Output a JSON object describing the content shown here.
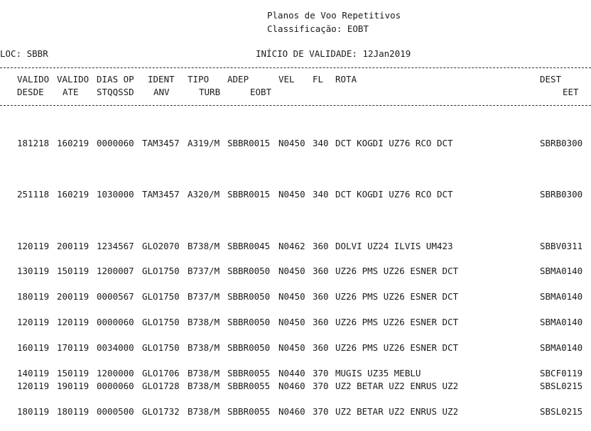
{
  "report": {
    "title": "Planos de Voo Repetitivos",
    "classification": "Classificação: EOBT",
    "loc": "LOC: SBBR",
    "validity": "INÍCIO DE VALIDADE: 12Jan2019"
  },
  "headers": {
    "row1": [
      {
        "text": "VALIDO",
        "col": "c0"
      },
      {
        "text": "VALIDO",
        "col": "c1"
      },
      {
        "text": "DIAS OP",
        "col": "c2"
      },
      {
        "text": "IDENT",
        "col": "c3i"
      },
      {
        "text": "TIPO",
        "col": "c4i"
      },
      {
        "text": "ADEP",
        "col": "c5i"
      },
      {
        "text": "VEL",
        "col": "c6i"
      },
      {
        "text": "FL",
        "col": "c7i"
      },
      {
        "text": "ROTA",
        "col": "c8"
      },
      {
        "text": "DEST",
        "col": "cd"
      }
    ],
    "row2": [
      {
        "text": "DESDE",
        "col": "c0"
      },
      {
        "text": "ATE",
        "col": "c1i"
      },
      {
        "text": "STQQSSD",
        "col": "c2"
      },
      {
        "text": "ANV",
        "col": "c3j"
      },
      {
        "text": "TURB",
        "col": "c4j"
      },
      {
        "text": "EOBT",
        "col": "c5j"
      },
      {
        "text": "EET",
        "col": "ce"
      }
    ]
  },
  "rows": [
    {
      "desde": "181218",
      "ate": "160219",
      "dias": "0000060",
      "ident": "TAM3457",
      "tipo": "A319/M",
      "adep": "SBBR0015",
      "vel": "N0450",
      "fl": "340",
      "rota": "DCT KOGDI UZ76 RCO DCT",
      "dest": "SBRB0300"
    },
    {
      "desde": "251118",
      "ate": "160219",
      "dias": "1030000",
      "ident": "TAM3457",
      "tipo": "A320/M",
      "adep": "SBBR0015",
      "vel": "N0450",
      "fl": "340",
      "rota": "DCT KOGDI UZ76 RCO DCT",
      "dest": "SBRB0300"
    },
    {
      "desde": "120119",
      "ate": "200119",
      "dias": "1234567",
      "ident": "GLO2070",
      "tipo": "B738/M",
      "adep": "SBBR0045",
      "vel": "N0462",
      "fl": "360",
      "rota": "DOLVI UZ24 ILVIS UM423",
      "dest": "SBBV0311"
    },
    {
      "desde": "130119",
      "ate": "150119",
      "dias": "1200007",
      "ident": "GLO1750",
      "tipo": "B737/M",
      "adep": "SBBR0050",
      "vel": "N0450",
      "fl": "360",
      "rota": "UZ26 PMS UZ26 ESNER DCT",
      "dest": "SBMA0140"
    },
    {
      "desde": "180119",
      "ate": "200119",
      "dias": "0000567",
      "ident": "GLO1750",
      "tipo": "B737/M",
      "adep": "SBBR0050",
      "vel": "N0450",
      "fl": "360",
      "rota": "UZ26 PMS UZ26 ESNER DCT",
      "dest": "SBMA0140"
    },
    {
      "desde": "120119",
      "ate": "120119",
      "dias": "0000060",
      "ident": "GLO1750",
      "tipo": "B738/M",
      "adep": "SBBR0050",
      "vel": "N0450",
      "fl": "360",
      "rota": "UZ26 PMS UZ26 ESNER DCT",
      "dest": "SBMA0140"
    },
    {
      "desde": "160119",
      "ate": "170119",
      "dias": "0034000",
      "ident": "GLO1750",
      "tipo": "B738/M",
      "adep": "SBBR0050",
      "vel": "N0450",
      "fl": "360",
      "rota": "UZ26 PMS UZ26 ESNER DCT",
      "dest": "SBMA0140"
    },
    {
      "desde": "140119",
      "ate": "150119",
      "dias": "1200000",
      "ident": "GLO1706",
      "tipo": "B738/M",
      "adep": "SBBR0055",
      "vel": "N0440",
      "fl": "370",
      "rota": "MUGIS UZ35 MEBLU",
      "dest": "SBCF0119"
    },
    {
      "desde": "120119",
      "ate": "190119",
      "dias": "0000060",
      "ident": "GLO1728",
      "tipo": "B738/M",
      "adep": "SBBR0055",
      "vel": "N0460",
      "fl": "370",
      "rota": "UZ2 BETAR UZ2 ENRUS UZ2",
      "dest": "SBSL0215"
    },
    {
      "desde": "180119",
      "ate": "180119",
      "dias": "0000500",
      "ident": "GLO1732",
      "tipo": "B738/M",
      "adep": "SBBR0055",
      "vel": "N0460",
      "fl": "370",
      "rota": "UZ2 BETAR UZ2 ENRUS UZ2",
      "dest": "SBSL0215"
    }
  ]
}
